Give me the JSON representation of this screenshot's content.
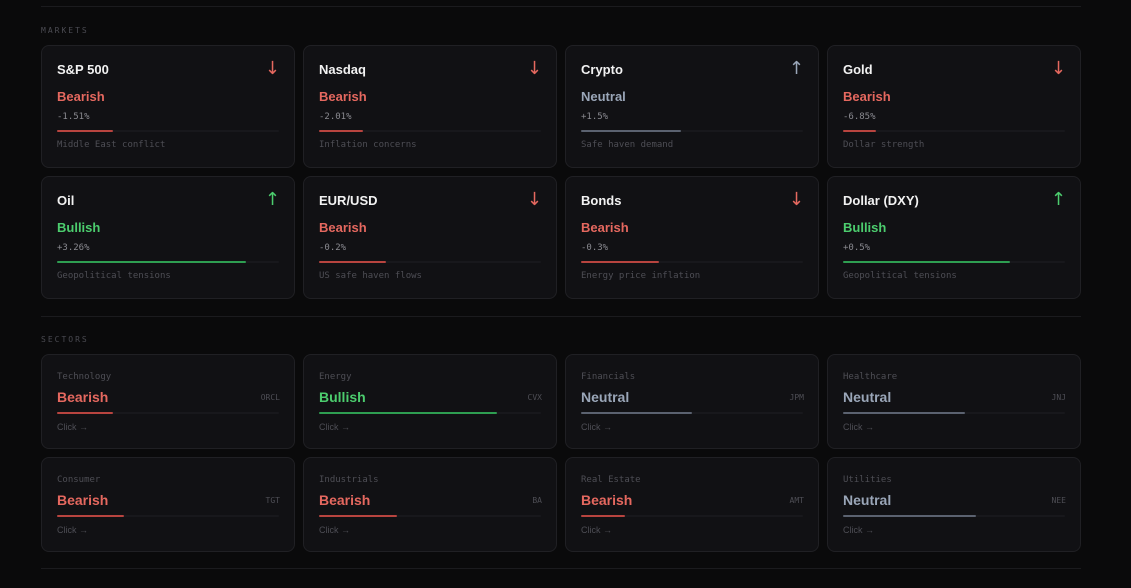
{
  "colors": {
    "bearish": "#e5685f",
    "bullish": "#4ccd6e",
    "neutral": "#9aa6b8"
  },
  "markets": {
    "label": "MARKETS",
    "items": [
      {
        "name": "S&P 500",
        "arrow": "↓",
        "status": "Bearish",
        "change": "-1.51%",
        "level": 0.25,
        "note": "Middle East conflict"
      },
      {
        "name": "Nasdaq",
        "arrow": "↓",
        "status": "Bearish",
        "change": "-2.01%",
        "level": 0.2,
        "note": "Inflation concerns"
      },
      {
        "name": "Crypto",
        "arrow": "↑",
        "status": "Neutral",
        "change": "+1.5%",
        "level": 0.45,
        "note": "Safe haven demand"
      },
      {
        "name": "Gold",
        "arrow": "↓",
        "status": "Bearish",
        "change": "-6.85%",
        "level": 0.15,
        "note": "Dollar strength"
      },
      {
        "name": "Oil",
        "arrow": "↑",
        "status": "Bullish",
        "change": "+3.26%",
        "level": 0.85,
        "note": "Geopolitical tensions"
      },
      {
        "name": "EUR/USD",
        "arrow": "↓",
        "status": "Bearish",
        "change": "-0.2%",
        "level": 0.3,
        "note": "US safe haven flows"
      },
      {
        "name": "Bonds",
        "arrow": "↓",
        "status": "Bearish",
        "change": "-0.3%",
        "level": 0.35,
        "note": "Energy price inflation"
      },
      {
        "name": "Dollar (DXY)",
        "arrow": "↑",
        "status": "Bullish",
        "change": "+0.5%",
        "level": 0.75,
        "note": "Geopolitical tensions"
      }
    ]
  },
  "sectors": {
    "label": "SECTORS",
    "items": [
      {
        "name": "Technology",
        "status": "Bearish",
        "ticker": "ORCL",
        "level": 0.25,
        "action": "Click →"
      },
      {
        "name": "Energy",
        "status": "Bullish",
        "ticker": "CVX",
        "level": 0.8,
        "action": "Click →"
      },
      {
        "name": "Financials",
        "status": "Neutral",
        "ticker": "JPM",
        "level": 0.5,
        "action": "Click →"
      },
      {
        "name": "Healthcare",
        "status": "Neutral",
        "ticker": "JNJ",
        "level": 0.55,
        "action": "Click →"
      },
      {
        "name": "Consumer",
        "status": "Bearish",
        "ticker": "TGT",
        "level": 0.3,
        "action": "Click →"
      },
      {
        "name": "Industrials",
        "status": "Bearish",
        "ticker": "BA",
        "level": 0.35,
        "action": "Click →"
      },
      {
        "name": "Real Estate",
        "status": "Bearish",
        "ticker": "AMT",
        "level": 0.2,
        "action": "Click →"
      },
      {
        "name": "Utilities",
        "status": "Neutral",
        "ticker": "NEE",
        "level": 0.6,
        "action": "Click →"
      }
    ]
  }
}
